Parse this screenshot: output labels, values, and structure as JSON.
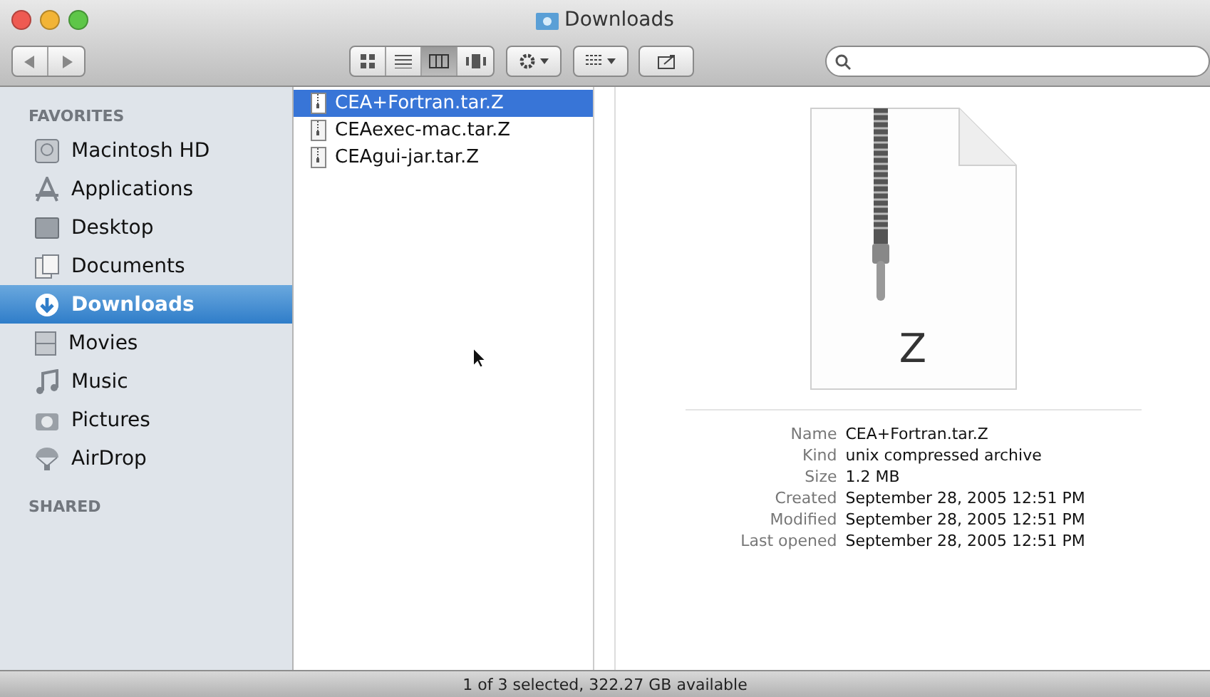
{
  "window": {
    "title": "Downloads"
  },
  "toolbar": {
    "view_modes": [
      {
        "kind": "icons",
        "selected": false
      },
      {
        "kind": "list",
        "selected": false
      },
      {
        "kind": "columns",
        "selected": true
      },
      {
        "kind": "coverflow",
        "selected": false
      }
    ]
  },
  "sidebar": {
    "sections": [
      {
        "title": "FAVORITES",
        "items": [
          {
            "name": "Macintosh HD",
            "kind": "disk",
            "selected": false
          },
          {
            "name": "Applications",
            "kind": "apps",
            "selected": false
          },
          {
            "name": "Desktop",
            "kind": "desktop",
            "selected": false
          },
          {
            "name": "Documents",
            "kind": "documents",
            "selected": false
          },
          {
            "name": "Downloads",
            "kind": "downloads",
            "selected": true
          },
          {
            "name": "Movies",
            "kind": "movies",
            "selected": false
          },
          {
            "name": "Music",
            "kind": "music",
            "selected": false
          },
          {
            "name": "Pictures",
            "kind": "pictures",
            "selected": false
          },
          {
            "name": "AirDrop",
            "kind": "airdrop",
            "selected": false
          }
        ]
      },
      {
        "title": "SHARED"
      }
    ]
  },
  "files": [
    {
      "name": "CEA+Fortran.tar.Z",
      "selected": true
    },
    {
      "name": "CEAexec-mac.tar.Z",
      "selected": false
    },
    {
      "name": "CEAgui-jar.tar.Z",
      "selected": false
    }
  ],
  "preview": {
    "badge": "Z",
    "info": [
      {
        "label": "Name",
        "value": "CEA+Fortran.tar.Z"
      },
      {
        "label": "Kind",
        "value": "unix compressed archive"
      },
      {
        "label": "Size",
        "value": "1.2 MB"
      },
      {
        "label": "Created",
        "value": "September 28, 2005 12:51 PM"
      },
      {
        "label": "Modified",
        "value": "September 28, 2005 12:51 PM"
      },
      {
        "label": "Last opened",
        "value": "September 28, 2005 12:51 PM"
      }
    ]
  },
  "status_bar": "1 of 3 selected, 322.27 GB available"
}
